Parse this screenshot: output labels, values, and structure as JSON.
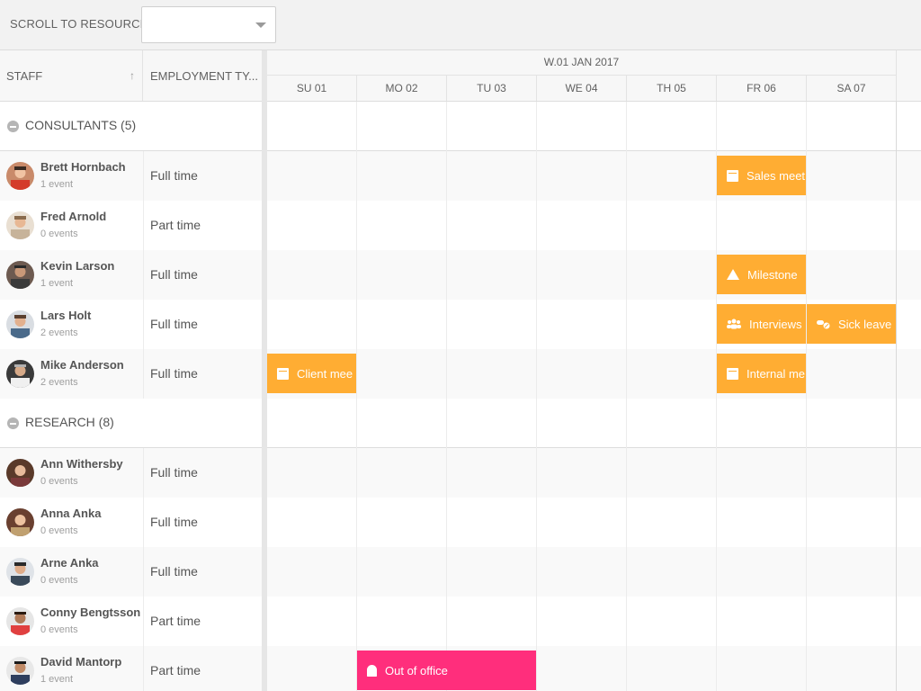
{
  "toolbar": {
    "scroll_label": "SCROLL TO RESOURCE",
    "scroll_value": ""
  },
  "columns": {
    "staff": "STAFF",
    "employment": "EMPLOYMENT TY...",
    "sort_indicator": "↑"
  },
  "timeline": {
    "week_label": "W.01 JAN 2017",
    "days": [
      "SU 01",
      "MO 02",
      "TU 03",
      "WE 04",
      "TH 05",
      "FR 06",
      "SA 07"
    ]
  },
  "groups": [
    {
      "label": "CONSULTANTS (5)",
      "resources": [
        {
          "name": "Brett Hornbach",
          "events": "1 event",
          "type": "Full time"
        },
        {
          "name": "Fred Arnold",
          "events": "0 events",
          "type": "Part time"
        },
        {
          "name": "Kevin Larson",
          "events": "1 event",
          "type": "Full time"
        },
        {
          "name": "Lars Holt",
          "events": "2 events",
          "type": "Full time"
        },
        {
          "name": "Mike Anderson",
          "events": "2 events",
          "type": "Full time"
        }
      ]
    },
    {
      "label": "RESEARCH (8)",
      "resources": [
        {
          "name": "Ann Withersby",
          "events": "0 events",
          "type": "Full time"
        },
        {
          "name": "Anna Anka",
          "events": "0 events",
          "type": "Full time"
        },
        {
          "name": "Arne Anka",
          "events": "0 events",
          "type": "Full time"
        },
        {
          "name": "Conny Bengtsson",
          "events": "0 events",
          "type": "Part time"
        },
        {
          "name": "David Mantorp",
          "events": "1 event",
          "type": "Part time"
        }
      ]
    }
  ],
  "events": [
    {
      "label": "Sales meet",
      "icon": "calendar-icon",
      "color": "#ffad33",
      "resource": "Brett Hornbach",
      "day": "FR 06"
    },
    {
      "label": "Milestone",
      "icon": "warning-icon",
      "color": "#ffad33",
      "resource": "Kevin Larson",
      "day": "FR 06"
    },
    {
      "label": "Interviews",
      "icon": "group-icon",
      "color": "#ffad33",
      "resource": "Lars Holt",
      "day": "FR 06"
    },
    {
      "label": "Sick leave",
      "icon": "pills-icon",
      "color": "#ffad33",
      "resource": "Lars Holt",
      "day": "SA 07"
    },
    {
      "label": "Client mee",
      "icon": "calendar-icon",
      "color": "#ffad33",
      "resource": "Mike Anderson",
      "day": "SU 01"
    },
    {
      "label": "Internal me",
      "icon": "calendar-icon",
      "color": "#ffad33",
      "resource": "Mike Anderson",
      "day": "FR 06"
    },
    {
      "label": "Out of office",
      "icon": "bell-icon",
      "color": "#ff2e7c",
      "resource": "David Mantorp",
      "day": "MO 02"
    }
  ]
}
